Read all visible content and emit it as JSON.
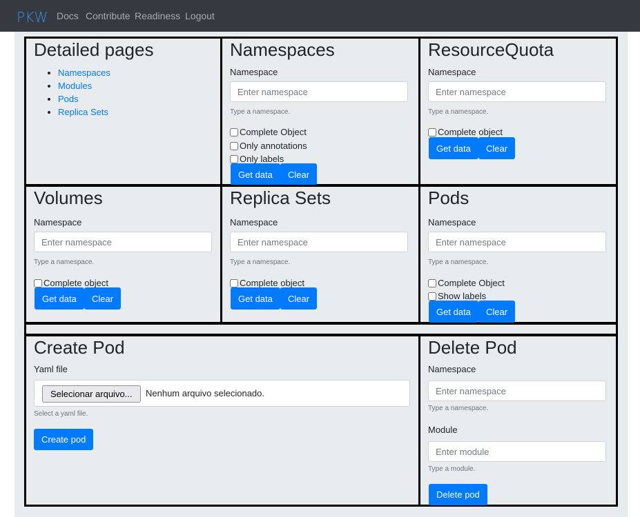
{
  "nav": {
    "brand": "PKW",
    "links": [
      "Docs",
      "Contribute",
      "Readiness",
      "Logout"
    ]
  },
  "detailed": {
    "title": "Detailed pages",
    "links": [
      "Namespaces",
      "Modules",
      "Pods",
      "Replica Sets"
    ]
  },
  "namespaces": {
    "title": "Namespaces",
    "label": "Namespace",
    "placeholder": "Enter namespace",
    "help": "Type a namespace.",
    "checks": [
      "Complete Object",
      "Only annotations",
      "Only labels"
    ],
    "get": "Get data",
    "clear": "Clear"
  },
  "quota": {
    "title": "ResourceQuota",
    "label": "Namespace",
    "placeholder": "Enter namespace",
    "help": "Type a namespace.",
    "checks": [
      "Complete object"
    ],
    "get": "Get data",
    "clear": "Clear"
  },
  "volumes": {
    "title": "Volumes",
    "label": "Namespace",
    "placeholder": "Enter namespace",
    "help": "Type a namespace.",
    "checks": [
      "Complete object"
    ],
    "get": "Get data",
    "clear": "Clear"
  },
  "replicasets": {
    "title": "Replica Sets",
    "label": "Namespace",
    "placeholder": "Enter namespace",
    "help": "Type a namespace.",
    "checks": [
      "Complete object"
    ],
    "get": "Get data",
    "clear": "Clear"
  },
  "pods": {
    "title": "Pods",
    "label": "Namespace",
    "placeholder": "Enter namespace",
    "help": "Type a namespace.",
    "checks": [
      "Complete Object",
      "Show labels"
    ],
    "get": "Get data",
    "clear": "Clear"
  },
  "createpod": {
    "title": "Create Pod",
    "label": "Yaml file",
    "file_button": "Selecionar arquivo...",
    "file_status": "Nenhum arquivo selecionado.",
    "help": "Select a yaml file.",
    "button": "Create pod"
  },
  "deletepod": {
    "title": "Delete Pod",
    "ns_label": "Namespace",
    "ns_placeholder": "Enter namespace",
    "ns_help": "Type a namespace.",
    "mod_label": "Module",
    "mod_placeholder": "Enter module",
    "mod_help": "Type a module.",
    "button": "Delete pod"
  }
}
